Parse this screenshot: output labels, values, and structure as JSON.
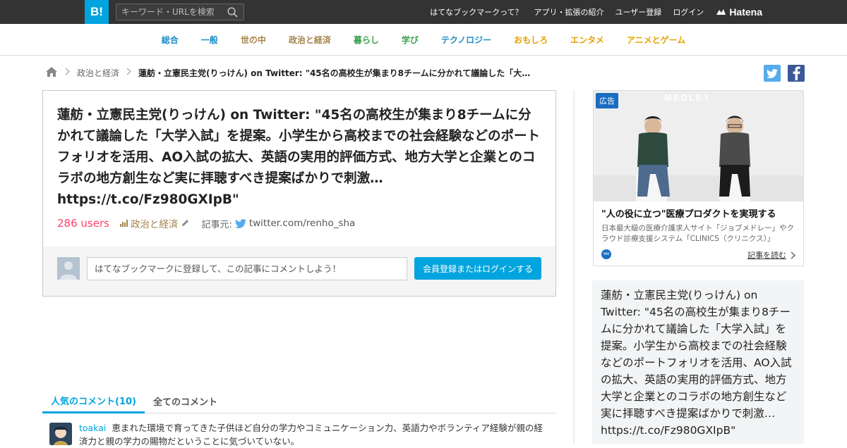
{
  "header": {
    "logo": "B!",
    "search_placeholder": "キーワード・URLを検索",
    "nav": [
      "はてなブックマークって？",
      "アプリ・拡張の紹介",
      "ユーザー登録",
      "ログイン"
    ],
    "brand": "Hatena"
  },
  "categories": [
    {
      "label": "総合",
      "color": "#1c8dc7"
    },
    {
      "label": "一般",
      "color": "#1c8dc7"
    },
    {
      "label": "世の中",
      "color": "#a5824a"
    },
    {
      "label": "政治と経済",
      "color": "#a5824a"
    },
    {
      "label": "暮らし",
      "color": "#38a14e"
    },
    {
      "label": "学び",
      "color": "#38a14e"
    },
    {
      "label": "テクノロジー",
      "color": "#1c8dc7"
    },
    {
      "label": "おもしろ",
      "color": "#e5a100"
    },
    {
      "label": "エンタメ",
      "color": "#e5a100"
    },
    {
      "label": "アニメとゲーム",
      "color": "#e5a100"
    }
  ],
  "breadcrumb": {
    "category": "政治と経済",
    "current": "蓮舫・立憲民主党(りっけん) on Twitter: \"45名の高校生が集まり8チームに分かれて議論した「大学入…"
  },
  "entry": {
    "title": "蓮舫・立憲民主党(りっけん) on Twitter: \"45名の高校生が集まり8チームに分かれて議論した「大学入試」を提案。小学生から高校までの社会経験などのポートフォリオを活用、AO入試の拡大、英語の実用的評価方式、地方大学と企業とのコラボの地方創生など実に拝聴すべき提案ばかりで刺激… https://t.co/Fz980GXIpB\"",
    "users": "286 users",
    "category": "政治と経済",
    "source_label": "記事元:",
    "source": "twitter.com/renho_sha",
    "comment_placeholder": "はてなブックマークに登録して、この記事にコメントしよう！",
    "login_button": "会員登録またはログインする"
  },
  "comments": {
    "tab_popular": "人気のコメント(10)",
    "tab_all": "全てのコメント",
    "items": [
      {
        "user": "toakai",
        "text": "恵まれた環境で育ってきた子供ほど自分の学力やコミュニケーション力、英語力やボランティア経験が親の経済力と親の学力の賜物だということに気づいていない。"
      }
    ]
  },
  "ad": {
    "badge": "広告",
    "watermark": "MEDLEY",
    "title": "\"人の役に立つ\"医療プロダクトを実現する",
    "description": "日本最大級の医療介護求人サイト「ジョブメドレー」やクラウド診療支援システム「CLINICS（クリニクス）」",
    "more": "記事を読む"
  },
  "summary": "蓮舫・立憲民主党(りっけん) on Twitter: \"45名の高校生が集まり8チームに分かれて議論した「大学入試」を提案。小学生から高校までの社会経験などのポートフォリオを活用、AO入試の拡大、英語の実用的評価方式、地方大学と企業とのコラボの地方創生など実に拝聴すべき提案ばかりで刺激… https://t.co/Fz980GXIpB\"",
  "colors": {
    "header_bg": "#333333",
    "accent": "#00a4de",
    "users": "#ff4166",
    "twitter": "#55acee",
    "facebook": "#3b5998"
  }
}
